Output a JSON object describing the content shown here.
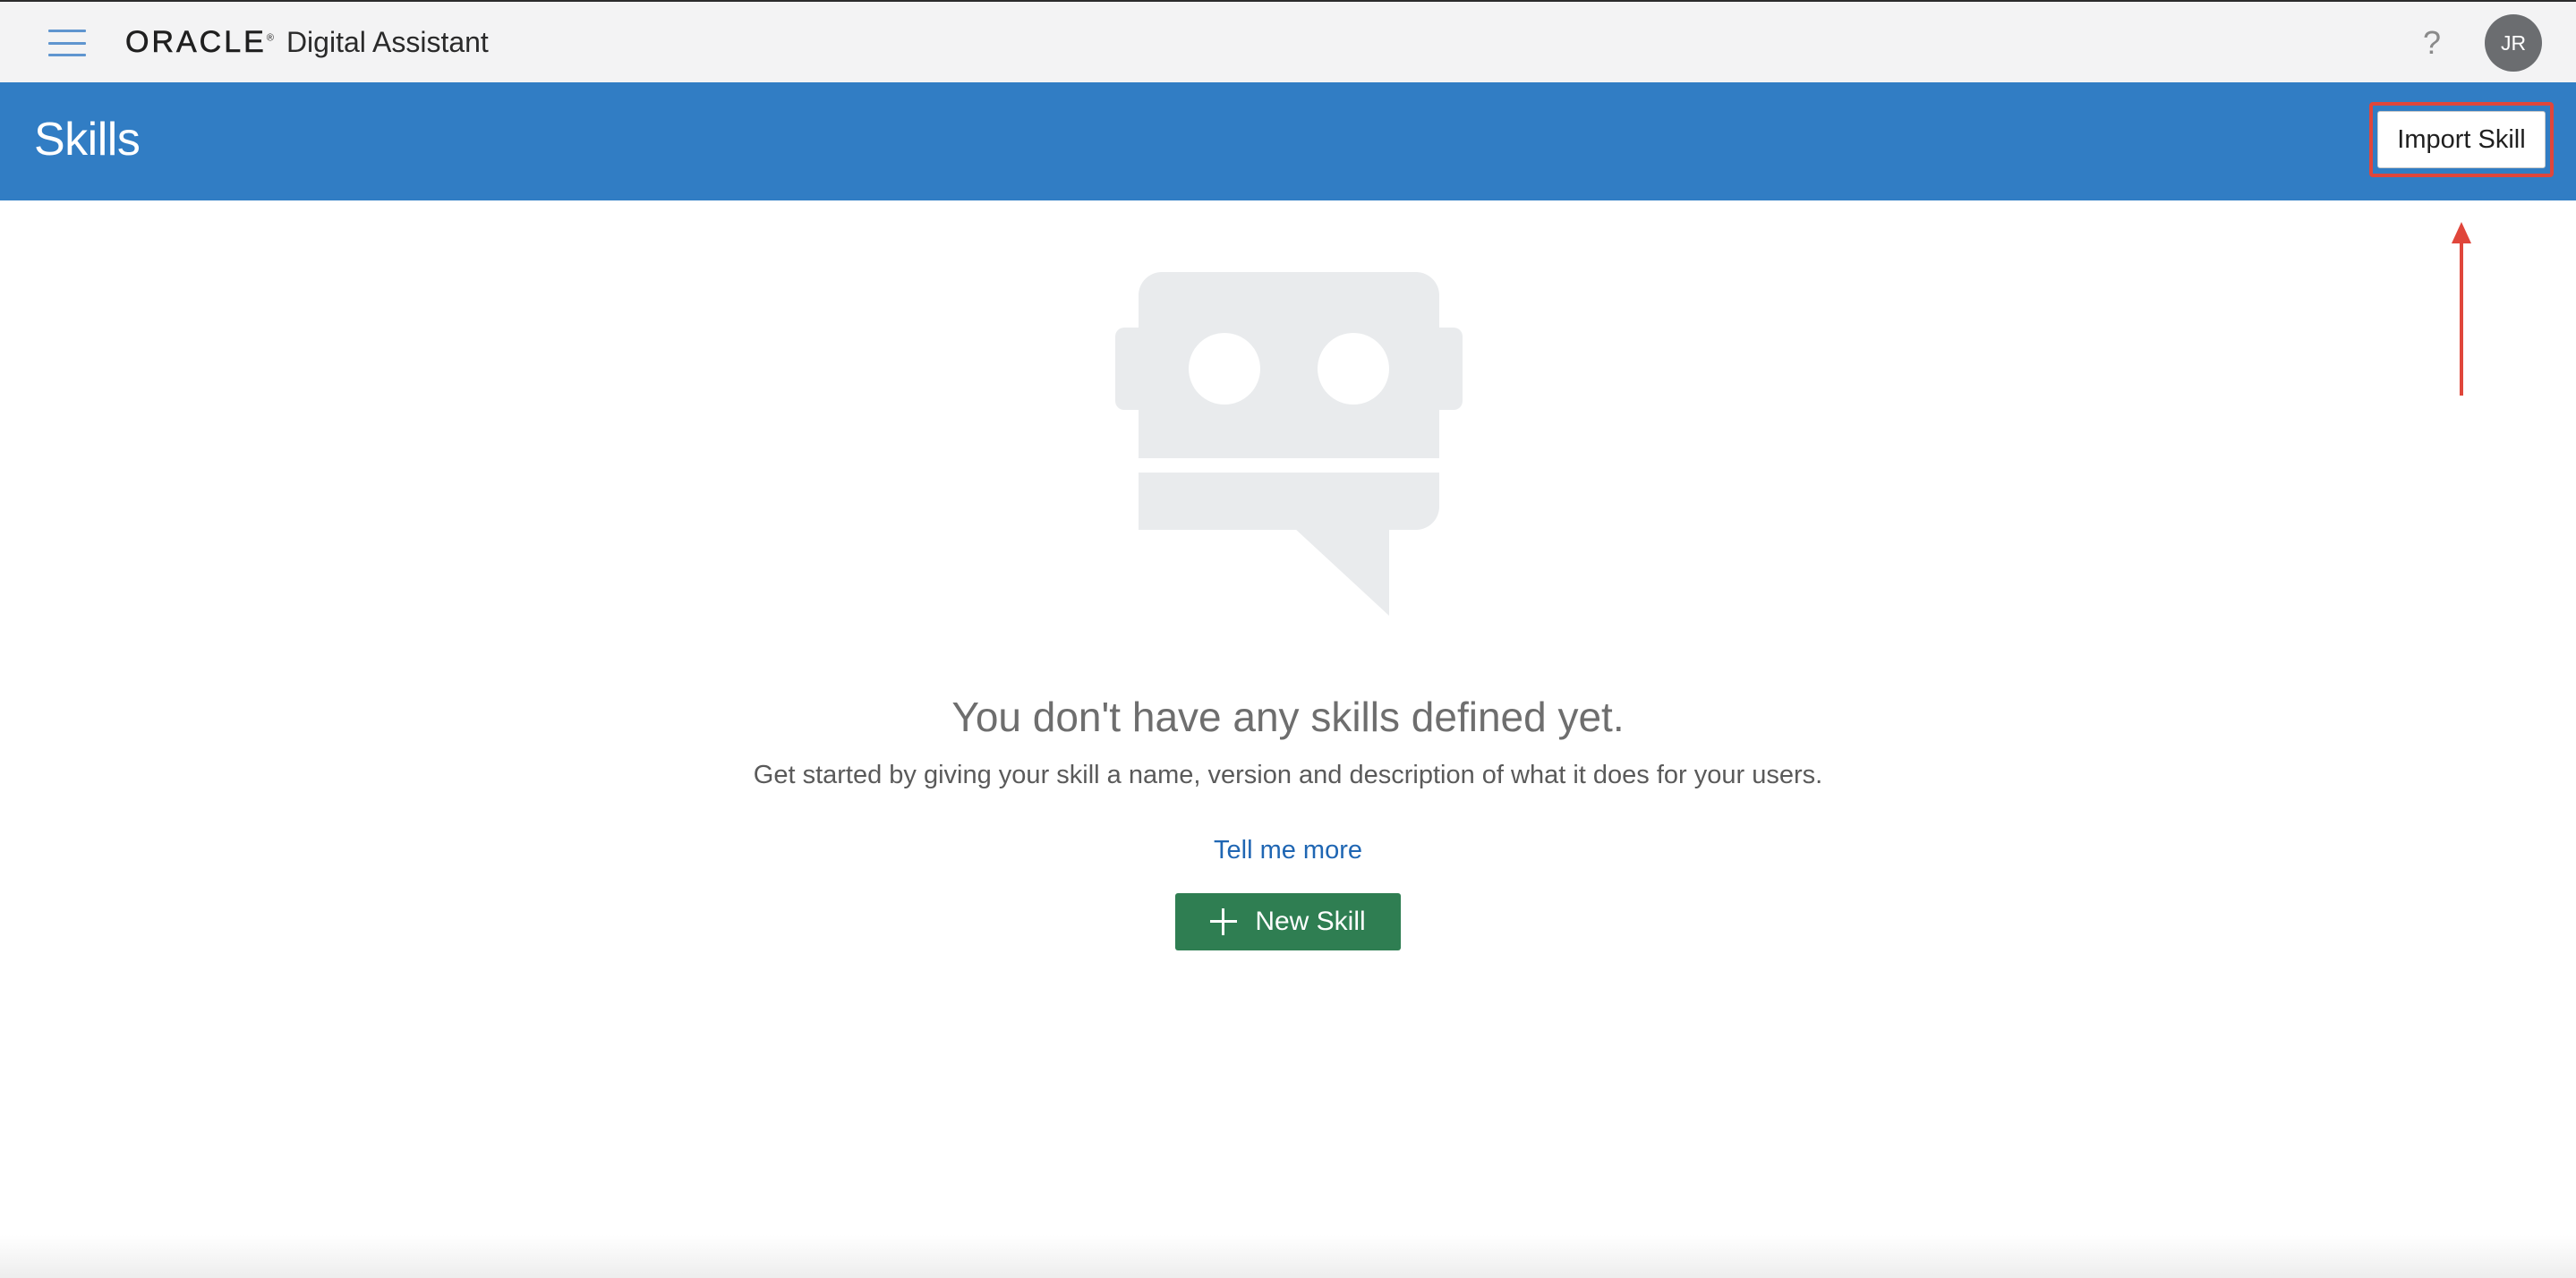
{
  "topbar": {
    "menu_icon": "hamburger-icon",
    "brand_logo": "ORACLE",
    "brand_registered": "®",
    "product_name": "Digital Assistant",
    "help_icon": "question-mark-icon",
    "help_glyph": "?",
    "avatar_initials": "JR"
  },
  "header": {
    "title": "Skills",
    "import_button_label": "Import Skill",
    "background_color": "#317dc4"
  },
  "empty_state": {
    "illustration_icon": "chat-bot-icon",
    "title": "You don't have any skills defined yet.",
    "description": "Get started by giving your skill a name, version and description of what it does for your users.",
    "link_label": "Tell me more",
    "new_button_label": "New Skill",
    "new_button_icon": "plus-icon",
    "new_button_color": "#2f7e52"
  },
  "annotation": {
    "highlight_color": "#e0463b",
    "arrow_icon": "arrow-up-icon"
  }
}
